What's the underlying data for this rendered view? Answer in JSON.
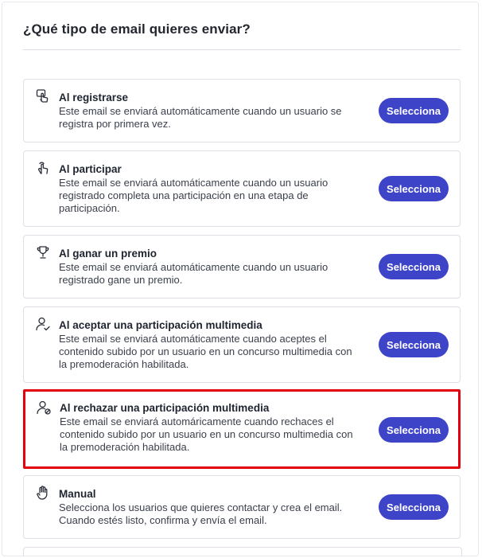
{
  "header": {
    "title": "¿Qué tipo de email quieres enviar?"
  },
  "select_label": "Selecciona",
  "cards": [
    {
      "icon": "hand-pointer-icon",
      "title": "Al registrarse",
      "description": "Este email se enviará automáticamente cuando un usuario se registra por primera vez.",
      "button": "Selecciona"
    },
    {
      "icon": "hand-tap-icon",
      "title": "Al participar",
      "description": "Este email se enviará automáticamente cuando un usuario registrado completa una participación en una etapa de participación.",
      "button": "Selecciona"
    },
    {
      "icon": "trophy-icon",
      "title": "Al ganar un premio",
      "description": "Este email se enviará automáticamente cuando un usuario registrado gane un premio.",
      "button": "Selecciona"
    },
    {
      "icon": "user-check-icon",
      "title": "Al aceptar una participación multimedia",
      "description": "Este email se enviará automáticamente cuando aceptes el contenido subido por un usuario en un concurso multimedia con la premoderación habilitada.",
      "button": "Selecciona"
    },
    {
      "icon": "user-reject-icon",
      "title": "Al rechazar una participación multimedia",
      "description": "Este email se enviará automáricamente cuando rechaces el contenido subido por un usuario en un concurso multimedia con la premoderación habilitada.",
      "button": "Selecciona",
      "highlighted": true,
      "highlight_color": "#e3000f"
    },
    {
      "icon": "hand-raise-icon",
      "title": "Manual",
      "description": "Selecciona los usuarios que quieres contactar y crea el email. Cuando estés listo, confirma y envía el email.",
      "button": "Selecciona"
    }
  ],
  "colors": {
    "button": "#3e44c8",
    "highlight": "#e3000f"
  }
}
